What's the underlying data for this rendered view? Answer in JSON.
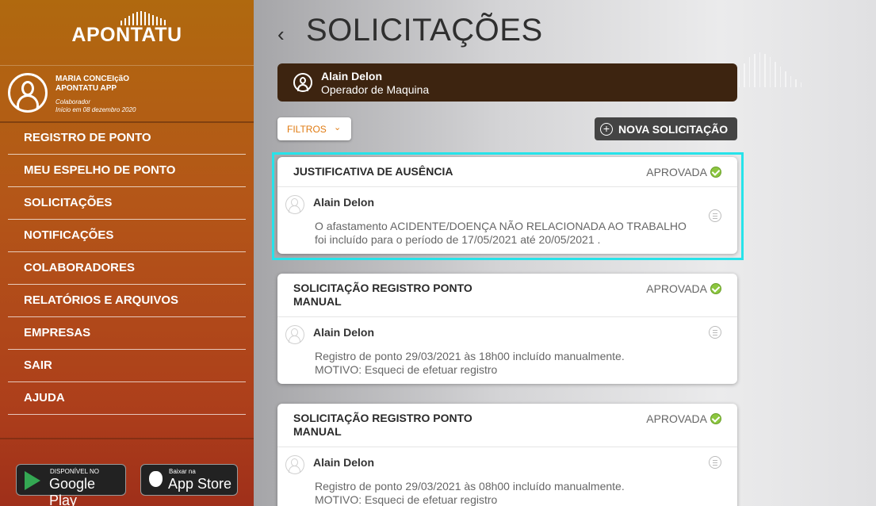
{
  "brand": {
    "name": "APONTATU"
  },
  "user": {
    "name_line1": "MARIA CONCEIçãO",
    "name_line2": "APONTATU APP",
    "role": "Colaborador",
    "since": "Início em 08 dezembro 2020"
  },
  "menu": [
    {
      "label": "REGISTRO DE PONTO"
    },
    {
      "label": "MEU ESPELHO DE PONTO"
    },
    {
      "label": "SOLICITAÇÕES"
    },
    {
      "label": "NOTIFICAÇÕES"
    },
    {
      "label": "COLABORADORES"
    },
    {
      "label": "RELATÓRIOS E ARQUIVOS"
    },
    {
      "label": "EMPRESAS"
    },
    {
      "label": "SAIR"
    },
    {
      "label": "AJUDA"
    }
  ],
  "stores": {
    "google_small": "DISPONÍVEL NO",
    "google_big": "Google Play",
    "apple_small": "Baixar na",
    "apple_big": "App Store"
  },
  "header": {
    "back_icon": "‹",
    "title": "SOLICITAÇÕES"
  },
  "banner": {
    "name": "Alain Delon",
    "role": "Operador de Maquina"
  },
  "toolbar": {
    "filter_label": "FILTROS",
    "filter_chevron": "⌄",
    "new_label": "NOVA SOLICITAÇÃO",
    "new_icon": "+"
  },
  "cards": [
    {
      "title": "JUSTIFICATIVA DE AUSÊNCIA",
      "status": "APROVADA",
      "user": "Alain Delon",
      "line1": "O afastamento ACIDENTE/DOENÇA NÃO RELACIONADA AO TRABALHO",
      "line2": "foi incluído para o período de 17/05/2021 até 20/05/2021 ."
    },
    {
      "title": "SOLICITAÇÃO REGISTRO PONTO MANUAL",
      "status": "APROVADA",
      "user": "Alain Delon",
      "line1": "Registro de ponto 29/03/2021 às 18h00 incluído manualmente.",
      "line2": "MOTIVO: Esqueci de efetuar registro"
    },
    {
      "title": "SOLICITAÇÃO REGISTRO PONTO MANUAL",
      "status": "APROVADA",
      "user": "Alain Delon",
      "line1": "Registro de ponto 29/03/2021 às 08h00 incluído manualmente.",
      "line2": "MOTIVO: Esqueci de efetuar registro"
    }
  ],
  "colors": {
    "accent": "#e07b12",
    "banner": "#3d2410",
    "approved": "#8cc63f",
    "highlight": "#27e3ea"
  }
}
